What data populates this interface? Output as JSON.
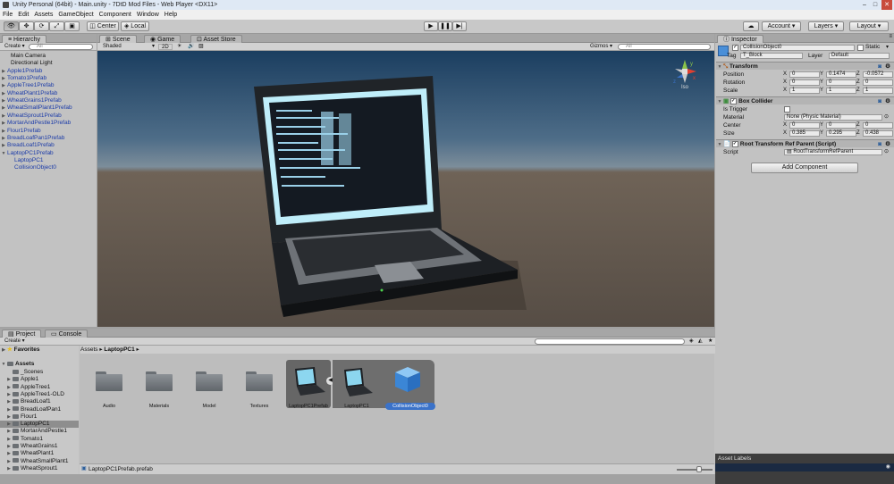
{
  "window": {
    "title": "Unity Personal (64bit) - Main.unity - 7DtD Mod Files - Web Player <DX11>"
  },
  "menu": [
    "File",
    "Edit",
    "Assets",
    "GameObject",
    "Component",
    "Window",
    "Help"
  ],
  "toolbar": {
    "pivot": "Center",
    "space": "Local",
    "account": "Account",
    "layers": "Layers",
    "layout": "Layout"
  },
  "hierarchy": {
    "tab": "Hierarchy",
    "create": "Create",
    "search_placeholder": "All",
    "items": [
      {
        "label": "Main Camera",
        "indent": 1,
        "prefab": false,
        "arrow": ""
      },
      {
        "label": "Directional Light",
        "indent": 1,
        "prefab": false,
        "arrow": ""
      },
      {
        "label": "Apple1Prefab",
        "indent": 0,
        "prefab": true,
        "arrow": "▶"
      },
      {
        "label": "Tomato1Prefab",
        "indent": 0,
        "prefab": true,
        "arrow": "▶"
      },
      {
        "label": "AppleTree1Prefab",
        "indent": 0,
        "prefab": true,
        "arrow": "▶"
      },
      {
        "label": "WheatPlant1Prefab",
        "indent": 0,
        "prefab": true,
        "arrow": "▶"
      },
      {
        "label": "WheatGrains1Prefab",
        "indent": 0,
        "prefab": true,
        "arrow": "▶"
      },
      {
        "label": "WheatSmallPlant1Prefab",
        "indent": 0,
        "prefab": true,
        "arrow": "▶"
      },
      {
        "label": "WheatSprout1Prefab",
        "indent": 0,
        "prefab": true,
        "arrow": "▶"
      },
      {
        "label": "MortarAndPestle1Prefab",
        "indent": 0,
        "prefab": true,
        "arrow": "▶"
      },
      {
        "label": "Flour1Prefab",
        "indent": 0,
        "prefab": true,
        "arrow": "▶"
      },
      {
        "label": "BreadLoafPan1Prefab",
        "indent": 0,
        "prefab": true,
        "arrow": "▶"
      },
      {
        "label": "BreadLoaf1Prefab",
        "indent": 0,
        "prefab": true,
        "arrow": "▶"
      },
      {
        "label": "LaptopPC1Prefab",
        "indent": 0,
        "prefab": true,
        "arrow": "▼"
      },
      {
        "label": "LaptopPC1",
        "indent": 2,
        "prefab": true,
        "arrow": ""
      },
      {
        "label": "CollisionObject0",
        "indent": 2,
        "prefab": true,
        "arrow": ""
      }
    ]
  },
  "scene": {
    "tabs": [
      "Scene",
      "Game",
      "Asset Store"
    ],
    "shading": "Shaded",
    "mode_2d": "2D",
    "gizmos": "Gizmos",
    "search_placeholder": "All",
    "persp": "Iso",
    "gizmo_axes": {
      "y": "y",
      "x": "x",
      "z": "z"
    }
  },
  "inspector": {
    "tab": "Inspector",
    "object_name": "CollisionObject0",
    "static_label": "Static",
    "tag_label": "Tag",
    "tag_value": "T_Block",
    "layer_label": "Layer",
    "layer_value": "Default",
    "transform": {
      "title": "Transform",
      "rows": [
        {
          "label": "Position",
          "x": "0",
          "y": "0.1474",
          "z": "-0.0572"
        },
        {
          "label": "Rotation",
          "x": "0",
          "y": "0",
          "z": "0"
        },
        {
          "label": "Scale",
          "x": "1",
          "y": "1",
          "z": "1"
        }
      ]
    },
    "box_collider": {
      "title": "Box Collider",
      "is_trigger": "Is Trigger",
      "material_label": "Material",
      "material_value": "None (Physic Material)",
      "center": {
        "label": "Center",
        "x": "0",
        "y": "0",
        "z": "0"
      },
      "size": {
        "label": "Size",
        "x": "0.385",
        "y": "0.295",
        "z": "0.438"
      }
    },
    "script_comp": {
      "title": "Root Transform Ref Parent (Script)",
      "script_label": "Script",
      "script_value": "RootTransformRefParent"
    },
    "add_component": "Add Component",
    "asset_labels": "Asset Labels"
  },
  "project": {
    "tabs": [
      "Project",
      "Console"
    ],
    "create": "Create",
    "favorites": "Favorites",
    "assets_root": "Assets",
    "breadcrumb": [
      "Assets",
      "LaptopPC1"
    ],
    "tree": [
      {
        "label": "_Scenes",
        "arrow": ""
      },
      {
        "label": "Apple1",
        "arrow": "▶"
      },
      {
        "label": "AppleTree1",
        "arrow": "▶"
      },
      {
        "label": "AppleTree1-OLD",
        "arrow": "▶"
      },
      {
        "label": "BreadLoaf1",
        "arrow": "▶"
      },
      {
        "label": "BreadLoafPan1",
        "arrow": "▶"
      },
      {
        "label": "Flour1",
        "arrow": "▶"
      },
      {
        "label": "LaptopPC1",
        "arrow": "▶"
      },
      {
        "label": "MortarAndPestle1",
        "arrow": "▶"
      },
      {
        "label": "Tomato1",
        "arrow": "▶"
      },
      {
        "label": "WheatGrains1",
        "arrow": "▶"
      },
      {
        "label": "WheatPlant1",
        "arrow": "▶"
      },
      {
        "label": "WheatSmallPlant1",
        "arrow": "▶"
      },
      {
        "label": "WheatSprout1",
        "arrow": "▶"
      }
    ],
    "assets": [
      "Audio",
      "Materials",
      "Model",
      "Textures",
      "LaptopPC1Prefab",
      "LaptopPC1",
      "CollisionObject0"
    ],
    "status_file": "LaptopPC1Prefab.prefab"
  },
  "colors": {
    "accent": "#3a72c9",
    "prefab_text": "#1a3aa8",
    "selection": "#7c93b8"
  }
}
